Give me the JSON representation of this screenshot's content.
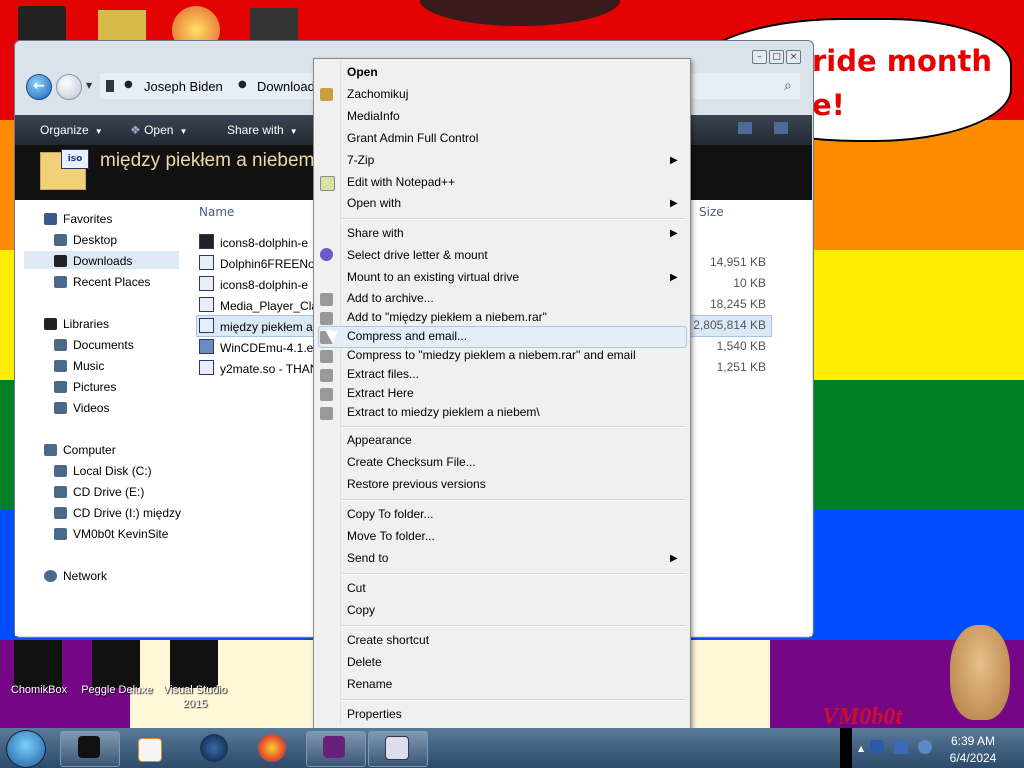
{
  "desktop": {
    "banner_line1": "ride month",
    "banner_line2": "e!",
    "logo": "VM0b0t",
    "icons": [
      {
        "label": "ChomikBox"
      },
      {
        "label": "Peggle Deluxe"
      },
      {
        "label": "Visual Studio 2015"
      }
    ],
    "rainbow_colors": [
      "#e40303",
      "#ff8c00",
      "#ffed00",
      "#008026",
      "#004dff",
      "#750787"
    ]
  },
  "explorer": {
    "breadcrumb": [
      "Joseph Biden",
      "Downloads"
    ],
    "toolbar": {
      "organize": "Organize",
      "open": "Open",
      "share_with": "Share with"
    },
    "header_title": "między piekłem a niebem",
    "header_icon_label": "iso",
    "columns": {
      "name": "Name",
      "size": "Size"
    },
    "nav": {
      "favorites": "Favorites",
      "desktop": "Desktop",
      "downloads": "Downloads",
      "recent": "Recent Places",
      "libraries": "Libraries",
      "documents": "Documents",
      "music": "Music",
      "pictures": "Pictures",
      "videos": "Videos",
      "computer": "Computer",
      "local_disk": "Local Disk (C:)",
      "cd_e": "CD Drive (E:)",
      "cd_i": "CD Drive (I:) między",
      "vm0b0t": "VM0b0t KevinSite",
      "network": "Network"
    },
    "files": [
      {
        "name": "icons8-dolphin-e",
        "size": ""
      },
      {
        "name": "Dolphin6FREENoS",
        "size": "14,951 KB"
      },
      {
        "name": "icons8-dolphin-e",
        "size": "10 KB"
      },
      {
        "name": "Media_Player_Cla",
        "size": "18,245 KB"
      },
      {
        "name": "między piekłem a",
        "size": "2,805,814 KB"
      },
      {
        "name": "WinCDEmu-4.1.ex",
        "size": "1,540 KB"
      },
      {
        "name": "y2mate.so - THAN",
        "size": "1,251 KB"
      }
    ]
  },
  "context_menu": {
    "open": "Open",
    "zachomikuj": "Zachomikuj",
    "mediainfo": "MediaInfo",
    "grant_admin": "Grant Admin Full Control",
    "seven_zip": "7-Zip",
    "notepad": "Edit with Notepad++",
    "open_with": "Open with",
    "share_with": "Share with",
    "select_drive": "Select drive letter & mount",
    "mount_existing": "Mount to an existing virtual drive",
    "add_archive": "Add to archive...",
    "add_rar": "Add to \"między piekłem a niebem.rar\"",
    "compress_email": "Compress and email...",
    "compress_rar_email": "Compress to \"miedzy pieklem a niebem.rar\" and email",
    "extract_files": "Extract files...",
    "extract_here": "Extract Here",
    "extract_to": "Extract to miedzy pieklem a niebem\\",
    "appearance": "Appearance",
    "checksum": "Create Checksum File...",
    "restore": "Restore previous versions",
    "copy_to": "Copy To folder...",
    "move_to": "Move To folder...",
    "send_to": "Send to",
    "cut": "Cut",
    "copy": "Copy",
    "create_shortcut": "Create shortcut",
    "delete": "Delete",
    "rename": "Rename",
    "properties": "Properties"
  },
  "taskbar": {
    "time": "6:39 AM",
    "date": "6/4/2024"
  }
}
